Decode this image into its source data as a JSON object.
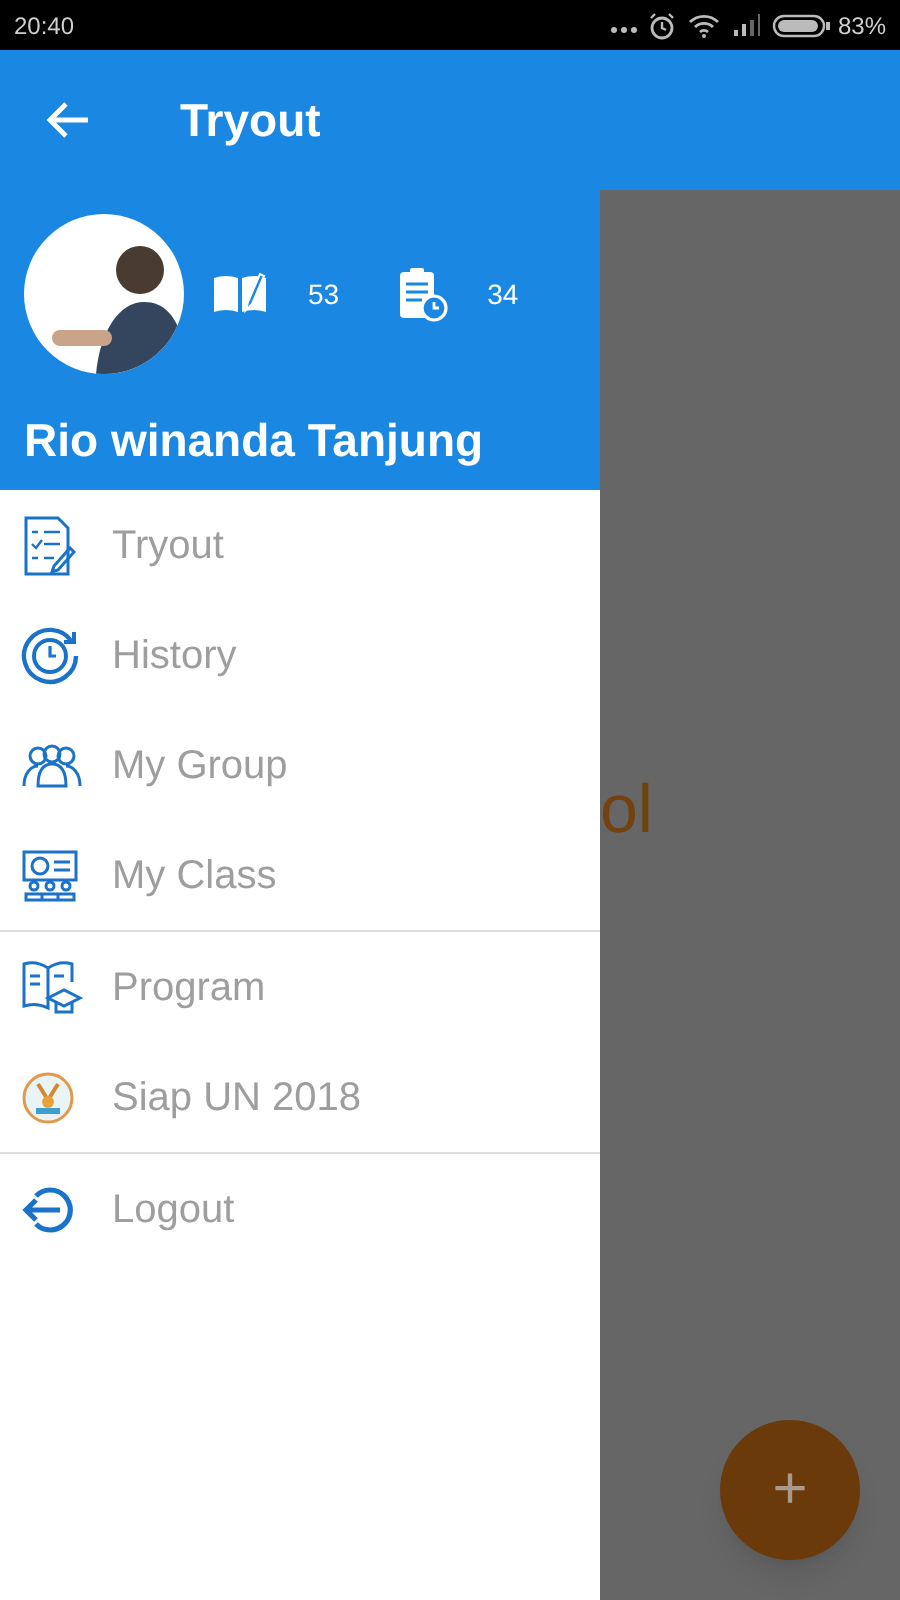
{
  "status_bar": {
    "time": "20:40",
    "battery": "83%"
  },
  "app_bar": {
    "title": "Tryout"
  },
  "profile": {
    "name": "Rio winanda Tanjung",
    "stats": [
      {
        "kind": "book",
        "value": "53"
      },
      {
        "kind": "clipboard",
        "value": "34"
      }
    ]
  },
  "menu_groups": [
    [
      {
        "kind": "checklist",
        "label": "Tryout"
      },
      {
        "kind": "history",
        "label": "History"
      },
      {
        "kind": "group",
        "label": "My Group"
      },
      {
        "kind": "class",
        "label": "My Class"
      }
    ],
    [
      {
        "kind": "program",
        "label": "Program"
      },
      {
        "kind": "badge",
        "label": "Siap UN 2018"
      }
    ],
    [
      {
        "kind": "logout",
        "label": "Logout"
      }
    ]
  ],
  "background": {
    "text": "ol"
  },
  "fab": {
    "label": "+"
  }
}
